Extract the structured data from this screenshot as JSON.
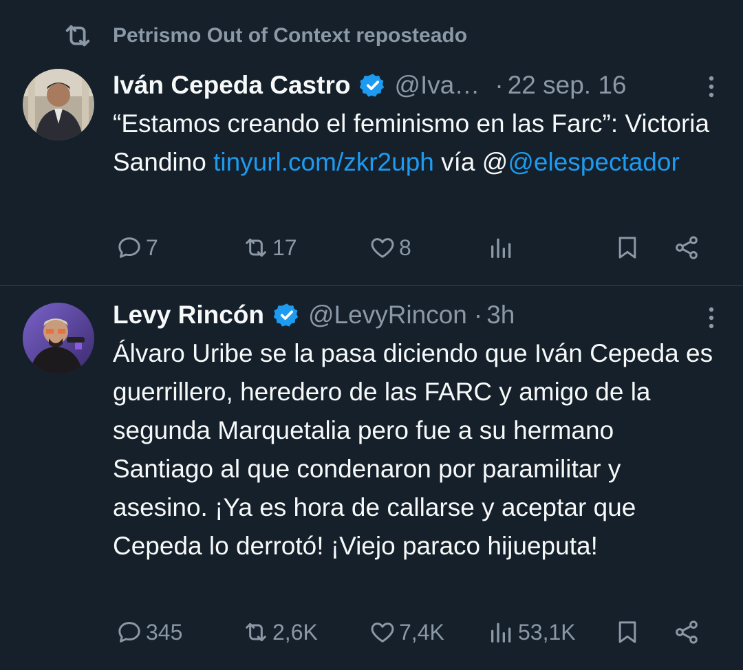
{
  "repost": {
    "label": "Petrismo Out of Context reposteado"
  },
  "tweets": [
    {
      "name": "Iván Cepeda Castro",
      "handle": "@Iva…",
      "time": "22 sep. 16",
      "text_before": "“Estamos creando el feminismo en las Farc”: Victoria Sandino ",
      "link": "tinyurl.com/zkr2uph",
      "text_middle": " vía @",
      "mention": "@elespectador",
      "replies": "7",
      "reposts": "17",
      "likes": "8",
      "views": ""
    },
    {
      "name": "Levy Rincón",
      "handle": "@LevyRincon",
      "time": "3h",
      "text": "Álvaro Uribe se la pasa diciendo que Iván Cepeda es guerrillero, heredero de las FARC y amigo de la segunda Marquetalia pero fue a su hermano Santiago al que condenaron por paramilitar y asesino. ¡Ya es hora de callarse y aceptar que Cepeda lo derrotó! ¡Viejo paraco hijueputa!",
      "replies": "345",
      "reposts": "2,6K",
      "likes": "7,4K",
      "views": "53,1K"
    }
  ],
  "colors": {
    "background": "#15202b",
    "accent": "#1d9bf0",
    "muted": "#8b98a5",
    "text": "#f7f9f9"
  }
}
